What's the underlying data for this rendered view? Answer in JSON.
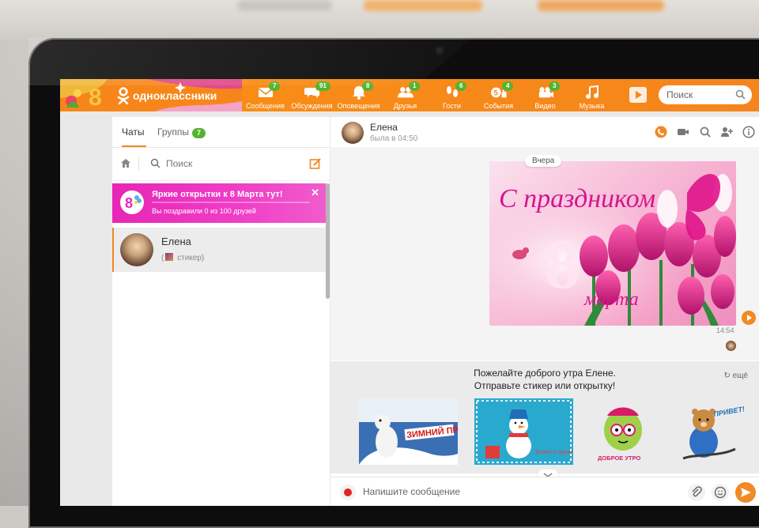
{
  "site": {
    "name": "одноклассники"
  },
  "nav": [
    {
      "label": "Сообщения",
      "count": "7",
      "icon": "envelope-icon"
    },
    {
      "label": "Обсуждения",
      "count": "91",
      "icon": "chat-bubbles-icon"
    },
    {
      "label": "Оповещения",
      "count": "8",
      "icon": "bell-icon"
    },
    {
      "label": "Друзья",
      "count": "1",
      "icon": "friends-icon"
    },
    {
      "label": "Гости",
      "count": "6",
      "icon": "footprints-icon"
    },
    {
      "label": "События",
      "count": "4",
      "icon": "events-icon"
    },
    {
      "label": "Видео",
      "count": "3",
      "icon": "video-camera-icon"
    },
    {
      "label": "Музыка",
      "count": "",
      "icon": "music-note-icon"
    }
  ],
  "search": {
    "placeholder": "Поиск"
  },
  "tabs": {
    "chats": "Чаты",
    "groups": "Группы",
    "groups_count": "7"
  },
  "chat_search": {
    "placeholder": "Поиск"
  },
  "promo": {
    "badge": "8",
    "title": "Яркие открытки к 8 Марта тут!",
    "subtitle": "Вы поздравили 0 из 100 друзей",
    "progress": 0
  },
  "chat_list": [
    {
      "name": "Елена",
      "preview_open": "(",
      "preview_text": "стикер)"
    }
  ],
  "conversation": {
    "name": "Елена",
    "last_seen": "была в 04:50",
    "date_label": "Вчера",
    "card_text_top": "С праздником",
    "card_text_bottom": "марта",
    "card_number": "8",
    "time": "14:54"
  },
  "suggestion": {
    "line1": "Пожелайте доброго утра Елене.",
    "line2": "Отправьте стикер или открытку!",
    "more": "ещё",
    "stickers": [
      {
        "caption": "ЗИМНИЙ ПРИВЕТ!"
      },
      {
        "caption": "Зимнего приветa!"
      },
      {
        "caption": "ДОБРОЕ УТРО"
      },
      {
        "caption": "ПРИВЕТ!"
      }
    ]
  },
  "composer": {
    "placeholder": "Напишите сообщение"
  },
  "colors": {
    "brand": "#f7861a",
    "badge": "#56b330",
    "promo": "#e726b6"
  }
}
